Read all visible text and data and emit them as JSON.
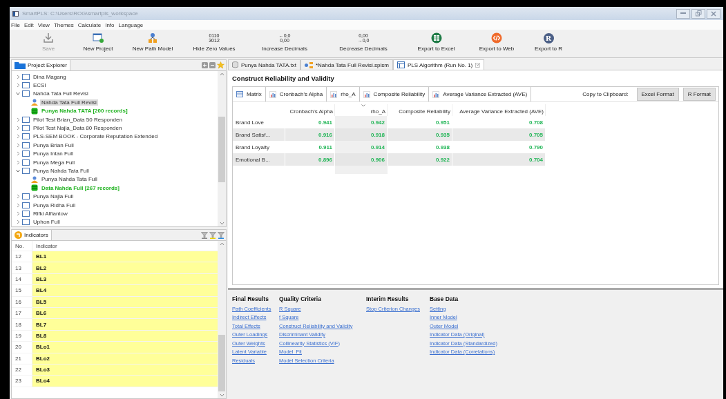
{
  "window": {
    "title": "SmartPLS: C:\\Users\\ROG\\smartpls_workspace"
  },
  "menu": [
    "File",
    "Edit",
    "View",
    "Themes",
    "Calculate",
    "Info",
    "Language"
  ],
  "toolbar": [
    {
      "kind": "save",
      "label": "Save",
      "disabled": true
    },
    {
      "kind": "new-project",
      "label": "New Project",
      "disabled": false
    },
    {
      "kind": "new-model",
      "label": "New Path Model",
      "disabled": false
    },
    {
      "kind": "digits",
      "label": "Hide Zero Values",
      "disabled": false,
      "icon_lines": [
        "0110",
        "3012"
      ]
    },
    {
      "kind": "digits",
      "label": "Increase Decimals",
      "disabled": false,
      "icon_lines": [
        "←0,0",
        "0,00"
      ]
    },
    {
      "kind": "digits",
      "label": "Decrease Decimals",
      "disabled": false,
      "icon_lines": [
        "0,00",
        "→0,0"
      ]
    },
    {
      "kind": "excel",
      "label": "Export to Excel",
      "disabled": false
    },
    {
      "kind": "web",
      "label": "Export to Web",
      "disabled": false
    },
    {
      "kind": "letter",
      "label": "Export to R",
      "disabled": false,
      "icon_text": "R"
    }
  ],
  "project_explorer": {
    "title": "Project Explorer",
    "items": [
      {
        "kind": "project",
        "label": "Dina Magang",
        "expanded": false,
        "selected": false
      },
      {
        "kind": "project",
        "label": "ECSI",
        "expanded": false,
        "selected": false
      },
      {
        "kind": "project",
        "label": "Nahda Tata Full Revisi",
        "expanded": true,
        "selected": false,
        "children": [
          {
            "kind": "model",
            "label": "Nahda Tata Full Revisi",
            "selected": true
          },
          {
            "kind": "data",
            "label": "Punya Nahda TATA [200 records]",
            "selected": false
          }
        ]
      },
      {
        "kind": "project",
        "label": "Pilot Test Brian_Data 50 Responden",
        "expanded": false,
        "selected": false
      },
      {
        "kind": "project",
        "label": "Pilot Test Najla_Data 80 Responden",
        "expanded": false,
        "selected": false
      },
      {
        "kind": "project",
        "label": "PLS-SEM BOOK - Corporate Reputation Extended",
        "expanded": false,
        "selected": false
      },
      {
        "kind": "project",
        "label": "Punya Brian Full",
        "expanded": false,
        "selected": false
      },
      {
        "kind": "project",
        "label": "Punya Intan Full",
        "expanded": false,
        "selected": false
      },
      {
        "kind": "project",
        "label": "Punya Mega Full",
        "expanded": false,
        "selected": false
      },
      {
        "kind": "project",
        "label": "Punya Nahda Tata Full",
        "expanded": true,
        "selected": false,
        "children": [
          {
            "kind": "model",
            "label": "Punya Nahda Tata Full",
            "selected": false
          },
          {
            "kind": "data",
            "label": "Data Nahda Full [267 records]",
            "selected": false
          }
        ]
      },
      {
        "kind": "project",
        "label": "Punya Najla Full",
        "expanded": false,
        "selected": false
      },
      {
        "kind": "project",
        "label": "Punya Ridha Full",
        "expanded": false,
        "selected": false
      },
      {
        "kind": "project",
        "label": "Rifki Alfiantow",
        "expanded": false,
        "selected": false
      },
      {
        "kind": "project",
        "label": "Uphon Full",
        "expanded": false,
        "selected": false
      }
    ]
  },
  "indicators": {
    "title": "Indicators",
    "columns": [
      "No.",
      "Indicator"
    ],
    "rows": [
      {
        "no": "12",
        "name": "BL1",
        "highlighted": true
      },
      {
        "no": "13",
        "name": "BL2",
        "highlighted": true
      },
      {
        "no": "14",
        "name": "BL3",
        "highlighted": true
      },
      {
        "no": "15",
        "name": "BL4",
        "highlighted": true
      },
      {
        "no": "16",
        "name": "BL5",
        "highlighted": true
      },
      {
        "no": "17",
        "name": "BL6",
        "highlighted": true
      },
      {
        "no": "18",
        "name": "BL7",
        "highlighted": true
      },
      {
        "no": "19",
        "name": "BL8",
        "highlighted": true
      },
      {
        "no": "20",
        "name": "BLo1",
        "highlighted": true
      },
      {
        "no": "21",
        "name": "BLo2",
        "highlighted": true
      },
      {
        "no": "22",
        "name": "BLo3",
        "highlighted": true
      },
      {
        "no": "23",
        "name": "BLo4",
        "highlighted": true
      }
    ]
  },
  "editor_tabs": [
    {
      "kind": "data",
      "label": "Punya Nahda TATA.txt",
      "selected": false,
      "closable": false
    },
    {
      "kind": "model",
      "label": "*Nahda Tata Full Revisi.splsm",
      "selected": false,
      "closable": false
    },
    {
      "kind": "report",
      "label": "PLS Algorithm (Run No. 1)",
      "selected": true,
      "closable": true
    }
  ],
  "report": {
    "title": "Construct Reliability and Validity",
    "view_tabs": [
      {
        "kind": "matrix",
        "label": "Matrix"
      },
      {
        "kind": "chart",
        "label": "Cronbach's Alpha"
      },
      {
        "kind": "chart",
        "label": "rho_A"
      },
      {
        "kind": "chart",
        "label": "Composite Reliability"
      },
      {
        "kind": "chart",
        "label": "Average Variance Extracted (AVE)"
      }
    ],
    "clipboard_label": "Copy to Clipboard:",
    "buttons": [
      "Excel Format",
      "R Format"
    ],
    "table": {
      "columns": [
        {
          "label": "Cronbach's Alpha",
          "selected": false
        },
        {
          "label": "rho_A",
          "selected": true
        },
        {
          "label": "Composite Reliability",
          "selected": false
        },
        {
          "label": "Average Variance Extracted (AVE)",
          "selected": false
        }
      ],
      "rows": [
        {
          "label": "Brand Love",
          "values": [
            "0.941",
            "0.942",
            "0.951",
            "0.708"
          ]
        },
        {
          "label": "Brand Satisf...",
          "values": [
            "0.916",
            "0.918",
            "0.935",
            "0.705"
          ]
        },
        {
          "label": "Brand Loyalty",
          "values": [
            "0.911",
            "0.914",
            "0.938",
            "0.790"
          ]
        },
        {
          "label": "Emotional B...",
          "values": [
            "0.896",
            "0.906",
            "0.922",
            "0.704"
          ]
        }
      ]
    }
  },
  "result_links": [
    {
      "heading": "Final Results",
      "links": [
        "Path Coefficients",
        "Indirect Effects",
        "Total Effects",
        "Outer Loadings",
        "Outer Weights",
        "Latent Variable",
        "Residuals"
      ]
    },
    {
      "heading": "Quality Criteria",
      "links": [
        "R Square",
        "f Square",
        "Construct Reliability and Validity",
        "Discriminant Validity",
        "Collinearity Statistics (VIF)",
        "Model_Fit",
        "Model Selection Criteria"
      ]
    },
    {
      "heading": "Interim Results",
      "links": [
        "Stop Criterion Changes"
      ]
    },
    {
      "heading": "Base Data",
      "links": [
        "Setting",
        "Inner Model",
        "Outer Model",
        "Indicator Data (Original)",
        "Indicator Data (Standardized)",
        "Indicator Data (Correlations)"
      ]
    }
  ]
}
